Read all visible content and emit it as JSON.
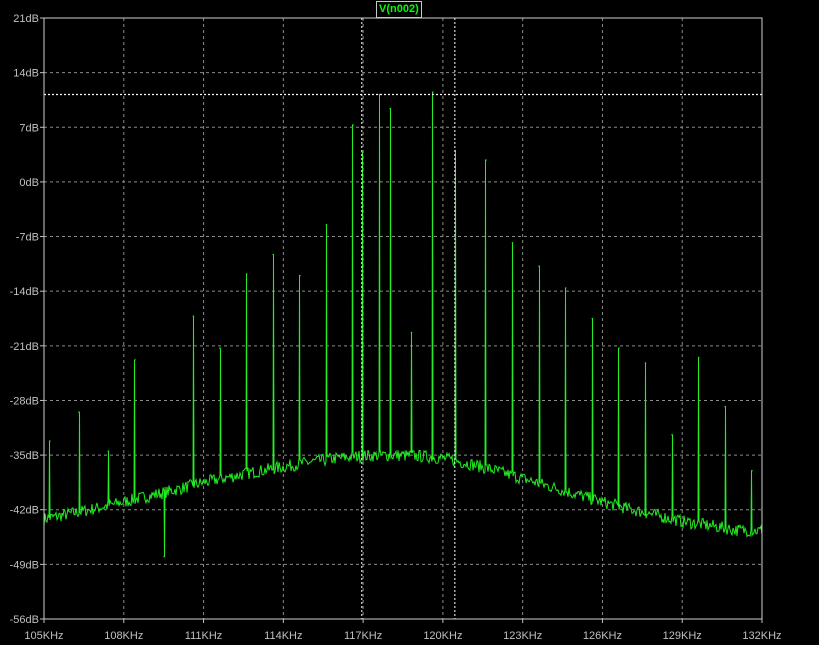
{
  "trace_label": "V(n002)",
  "colors": {
    "background": "#000000",
    "trace": "#22ee22",
    "grid": "#8a8a8a",
    "axis_text": "#c0c0c0",
    "cursor": "#ffffff",
    "label_text": "#00ff00"
  },
  "chart_data": {
    "type": "line",
    "title": "",
    "xlabel": "",
    "ylabel": "",
    "grid": true,
    "xlim": [
      105,
      132
    ],
    "ylim": [
      -56,
      21
    ],
    "x_unit": "KHz",
    "y_unit": "dB",
    "x_ticks": [
      "105KHz",
      "108KHz",
      "111KHz",
      "114KHz",
      "117KHz",
      "120KHz",
      "123KHz",
      "126KHz",
      "129KHz",
      "132KHz"
    ],
    "y_ticks": [
      "21dB",
      "14dB",
      "7dB",
      "0dB",
      "-7dB",
      "-14dB",
      "-21dB",
      "-28dB",
      "-35dB",
      "-42dB",
      "-49dB",
      "-56dB"
    ],
    "cursors": {
      "vertical_x": [
        116.95,
        120.45
      ],
      "horizontal_y": 11.2
    },
    "series": [
      {
        "name": "V(n002)",
        "noise_floor": [
          [
            105,
            -43.2
          ],
          [
            106,
            -42.5
          ],
          [
            107,
            -41.8
          ],
          [
            108,
            -41.0
          ],
          [
            109,
            -40.2
          ],
          [
            110,
            -39.4
          ],
          [
            111,
            -38.5
          ],
          [
            112,
            -37.8
          ],
          [
            113,
            -37.1
          ],
          [
            114,
            -36.5
          ],
          [
            115,
            -35.9
          ],
          [
            116,
            -35.4
          ],
          [
            117,
            -35.1
          ],
          [
            118,
            -35.0
          ],
          [
            119,
            -35.1
          ],
          [
            120,
            -35.4
          ],
          [
            121,
            -36.1
          ],
          [
            122,
            -37.0
          ],
          [
            123,
            -38.0
          ],
          [
            124,
            -39.0
          ],
          [
            125,
            -40.0
          ],
          [
            126,
            -41.0
          ],
          [
            127,
            -41.9
          ],
          [
            128,
            -42.7
          ],
          [
            129,
            -43.5
          ],
          [
            130,
            -44.0
          ],
          [
            131,
            -44.6
          ],
          [
            132,
            -44.7
          ]
        ],
        "peaks": [
          [
            105.2,
            -33.2
          ],
          [
            106.3,
            -29.5
          ],
          [
            107.4,
            -34.5
          ],
          [
            108.4,
            -22.8
          ],
          [
            109.5,
            -48.0
          ],
          [
            110.6,
            -17.2
          ],
          [
            111.6,
            -21.3
          ],
          [
            112.6,
            -11.8
          ],
          [
            113.6,
            -9.3
          ],
          [
            114.6,
            -12.0
          ],
          [
            115.6,
            -5.5
          ],
          [
            116.6,
            7.3
          ],
          [
            116.95,
            3.8
          ],
          [
            117.6,
            11.2
          ],
          [
            118.0,
            9.4
          ],
          [
            118.8,
            -19.3
          ],
          [
            119.6,
            11.5
          ],
          [
            120.45,
            4.0
          ],
          [
            121.6,
            2.8
          ],
          [
            122.6,
            -7.8
          ],
          [
            123.6,
            -10.8
          ],
          [
            124.6,
            -13.6
          ],
          [
            125.6,
            -17.5
          ],
          [
            126.6,
            -21.3
          ],
          [
            127.6,
            -23.2
          ],
          [
            128.6,
            -32.4
          ],
          [
            129.6,
            -22.5
          ],
          [
            130.6,
            -28.8
          ],
          [
            131.6,
            -37.0
          ]
        ]
      }
    ]
  }
}
